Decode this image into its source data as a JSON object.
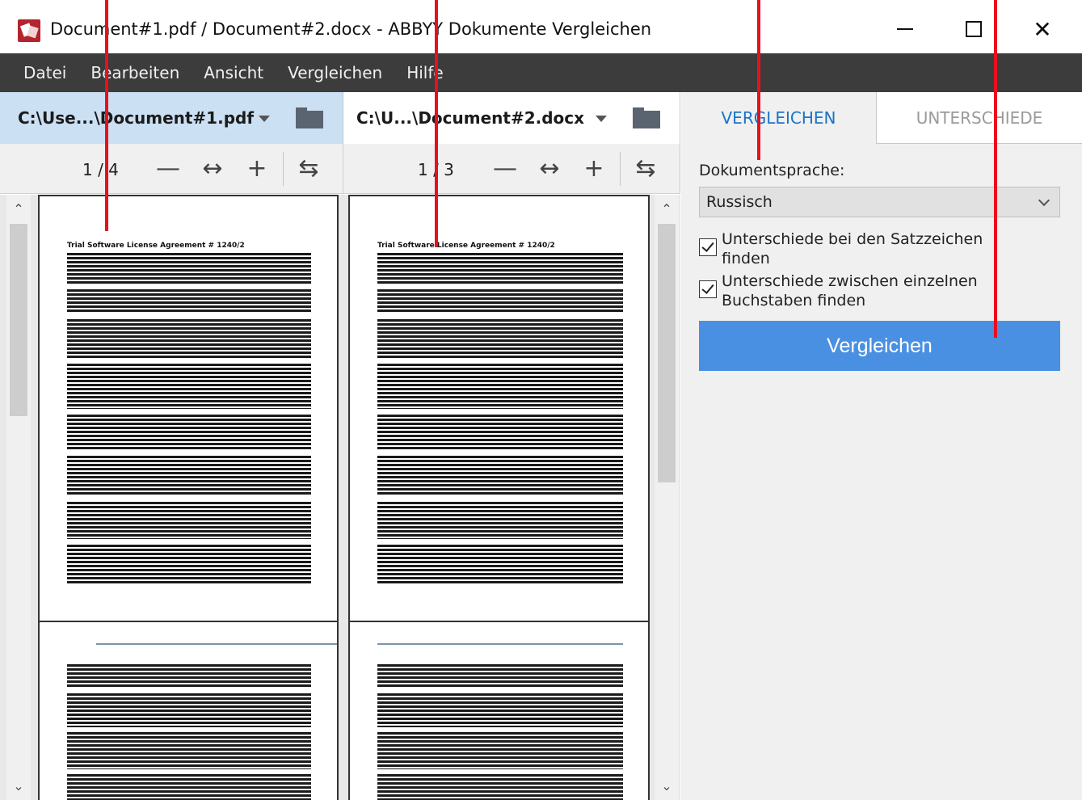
{
  "window": {
    "title": "Document#1.pdf / Document#2.docx - ABBYY Dokumente Vergleichen",
    "minimize": "minimize",
    "maximize": "maximize",
    "close": "✕"
  },
  "menu": [
    "Datei",
    "Bearbeiten",
    "Ansicht",
    "Vergleichen",
    "Hilfe"
  ],
  "documents": [
    {
      "path": "C:\\Use...\\Document#1.pdf",
      "page_counter": "1 / 4",
      "page_title": "Trial Software License Agreement # 1240/2"
    },
    {
      "path": "C:\\U...\\Document#2.docx",
      "page_counter": "1 / 3",
      "page_title": "Trial Software License Agreement # 1240/2"
    }
  ],
  "toolbar": {
    "zoom_out": "—",
    "fit_width": "↔",
    "zoom_in": "+",
    "sync": "⇆"
  },
  "panel": {
    "tab_compare": "VERGLEICHEN",
    "tab_differences": "UNTERSCHIEDE",
    "language_label": "Dokumentsprache:",
    "language_value": "Russisch",
    "option_punctuation": "Unterschiede bei den Satzzeichen finden",
    "option_letters": "Unterschiede zwischen einzelnen Buchstaben finden",
    "compare_button": "Vergleichen"
  },
  "colors": {
    "accent": "#4a90e2",
    "menubar": "#3c3c3c",
    "selected_header": "#cce0f3",
    "callout": "#e8101a"
  }
}
